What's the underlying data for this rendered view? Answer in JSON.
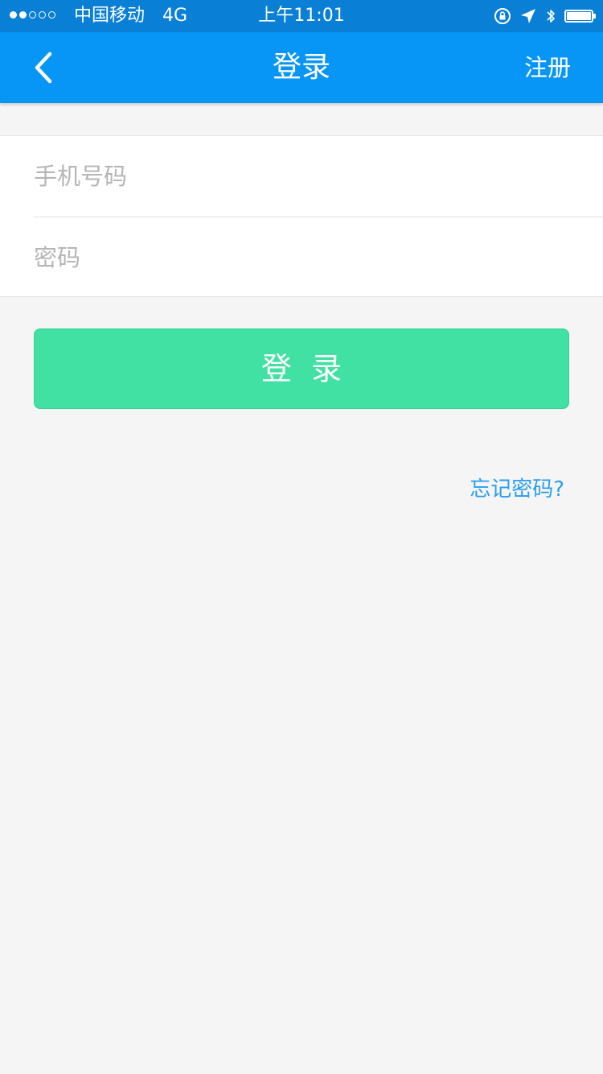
{
  "status_bar": {
    "carrier": "中国移动",
    "network": "4G",
    "time": "上午11:01",
    "signal_strength": 2,
    "signal_max": 5
  },
  "nav": {
    "back_icon": "chevron-left-icon",
    "title": "登录",
    "register_label": "注册"
  },
  "form": {
    "phone_placeholder": "手机号码",
    "password_placeholder": "密码"
  },
  "login_button_label": "登  录",
  "forgot_password_label": "忘记密码?",
  "colors": {
    "status_bar": "#0a7fd6",
    "nav_bar": "#0795f6",
    "login_button": "#41e0a3",
    "link": "#2a9ef0",
    "background": "#f5f5f5"
  }
}
